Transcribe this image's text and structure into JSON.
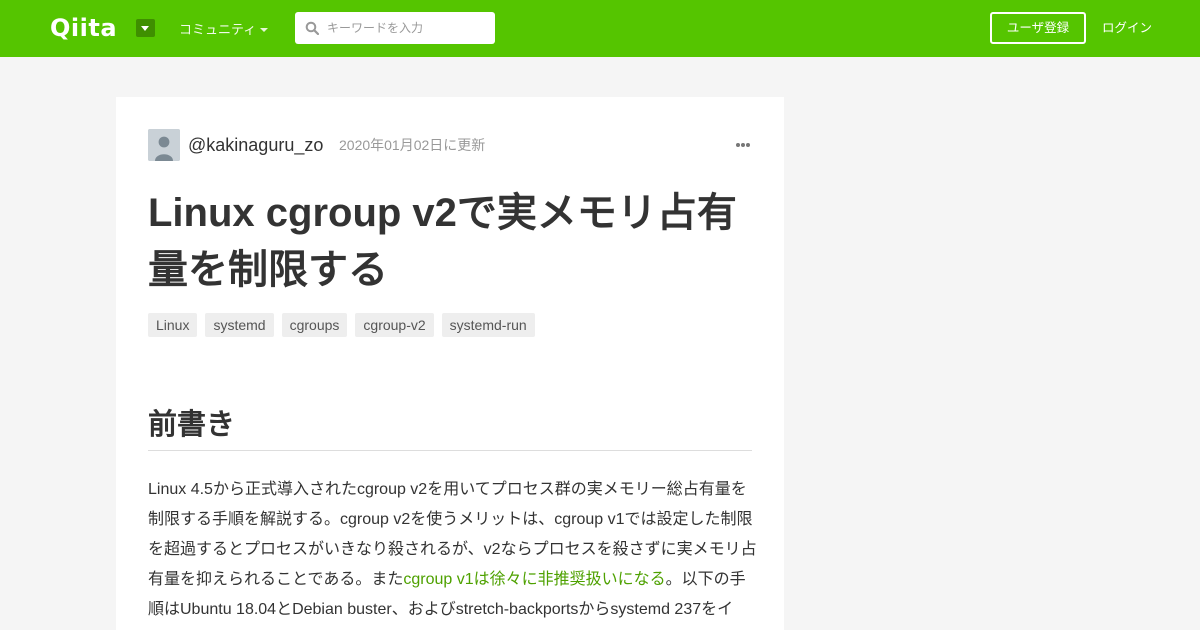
{
  "header": {
    "logo": "Qiita",
    "community_label": "コミュニティ",
    "search_placeholder": "キーワードを入力",
    "signup_label": "ユーザ登録",
    "login_label": "ログイン"
  },
  "article": {
    "author": "@kakinaguru_zo",
    "updated": "2020年01月02日に更新",
    "title": "Linux cgroup v2で実メモリ占有量を制限する",
    "tags": [
      "Linux",
      "systemd",
      "cgroups",
      "cgroup-v2",
      "systemd-run"
    ],
    "section_heading": "前書き",
    "paragraph": {
      "before_link": "Linux 4.5から正式導入されたcgroup v2を用いてプロセス群の実メモリー総占有量を制限する手順を解説する。cgroup v2を使うメリットは、cgroup v1では設定した制限を超過するとプロセスがいきなり殺されるが、v2ならプロセスを殺さずに実メモリ占有量を抑えられることである。また",
      "link": "cgroup v1は徐々に非推奨扱いになる",
      "after_link": "。以下の手順はUbuntu 18.04とDebian buster、およびstretch-backportsからsystemd 237をイ"
    }
  },
  "colors": {
    "brand_green": "#55c500",
    "link_green": "#4ea100"
  },
  "icons": [
    "search-icon",
    "caret-down-icon",
    "more-icon",
    "avatar"
  ]
}
